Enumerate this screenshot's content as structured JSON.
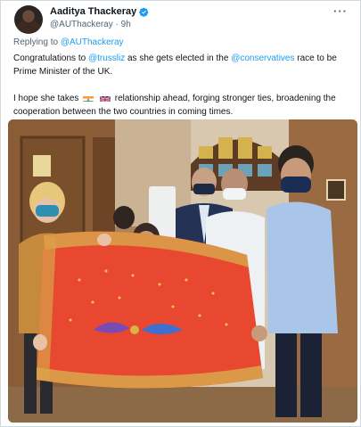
{
  "tweet": {
    "author_name": "Aaditya Thackeray",
    "author_handle": "@AUThackeray",
    "separator": "·",
    "time": "9h",
    "more_icon": "···",
    "replying_prefix": "Replying to",
    "replying_to": "@AUThackeray",
    "line1_a": "Congratulations to",
    "mention_truss": "@trussliz",
    "line1_b": "as she gets elected in the",
    "mention_conservatives": "@conservatives",
    "line1_c": "race to be Prime Minister of the UK.",
    "line2_a": "I hope she takes",
    "line2_b": "relationship ahead, forging stronger ties, broadening the cooperation between the two countries in coming times.",
    "flags": [
      "india-flag",
      "uk-flag"
    ],
    "photo_icon": "group-photo-holding-paithani-saree"
  },
  "colors": {
    "link": "#1d9bf0",
    "text": "#0f1419",
    "secondary": "#536471",
    "verified": "#1d9bf0",
    "saree": "#e8482f",
    "saree_border": "#d9a24a"
  }
}
